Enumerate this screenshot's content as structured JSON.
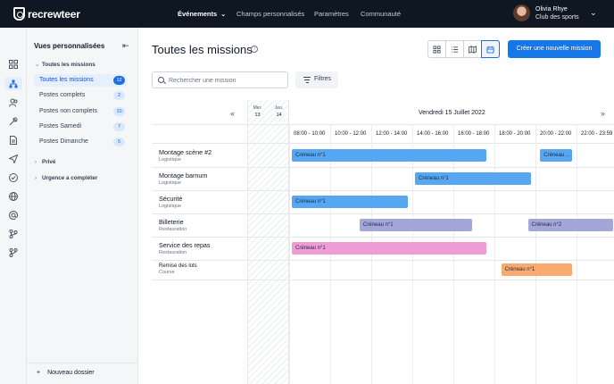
{
  "app": {
    "logo_text": "recrewteer"
  },
  "topnav": {
    "items": [
      "Événements",
      "Champs personnalisés",
      "Paramètres",
      "Communauté"
    ]
  },
  "user": {
    "name": "Olivia Rhye",
    "club": "Club des sports"
  },
  "panel": {
    "title": "Vues personnalisées",
    "group_missions": "Toutes les missions",
    "views": [
      {
        "label": "Toutes les missions",
        "count": "12"
      },
      {
        "label": "Postes complets",
        "count": "2"
      },
      {
        "label": "Postes non complets",
        "count": "10"
      },
      {
        "label": "Postes Samedi",
        "count": "7"
      },
      {
        "label": "Postes Dimanche",
        "count": "5"
      }
    ],
    "group_private": "Privé",
    "group_urgent": "Urgence a compléter",
    "new_folder": "Nouveau dossier"
  },
  "main": {
    "title": "Toutes les missions",
    "create_button": "Créer une nouvelle mission",
    "search_placeholder": "Rechercher une mission",
    "filter_label": "Filtres"
  },
  "calendar": {
    "date_title": "Vendredi 15 Juillet 2022",
    "prev_days": [
      {
        "name": "Mer.",
        "num": "13"
      },
      {
        "name": "Jeu.",
        "num": "14"
      }
    ],
    "slots": [
      "08:00 - 10:00",
      "10:00 - 12:00",
      "12:00 - 14:00",
      "14:00 - 16:00",
      "16:00 - 18:00",
      "18:00 - 20:00",
      "20:00 - 22:00",
      "22:00 - 23:59"
    ],
    "missions": [
      {
        "title": "Montage scène #2",
        "category": "Logistique"
      },
      {
        "title": "Montage barnum",
        "category": "Logistique"
      },
      {
        "title": "Sécurité",
        "category": "Logistique"
      },
      {
        "title": "Billeterie",
        "category": "Restauration"
      },
      {
        "title": "Service des repas",
        "category": "Restauration"
      },
      {
        "title": "Remise des lots",
        "category": "Course"
      }
    ],
    "shifts": [
      {
        "label": "Créneau n°1",
        "color": "#56a6f2"
      },
      {
        "label": "Créneau ...",
        "color": "#56a6f2"
      },
      {
        "label": "Créneau n°1",
        "color": "#56a6f2"
      },
      {
        "label": "Créneau n°1",
        "color": "#56a6f2"
      },
      {
        "label": "Créneau n°1",
        "color": "#a3a6d8"
      },
      {
        "label": "Créneau n°2",
        "color": "#a3a6d8"
      },
      {
        "label": "Créneau n°1",
        "color": "#ef9bd6"
      },
      {
        "label": "Créneau n°1",
        "color": "#f9ab6f"
      }
    ]
  },
  "colors": {
    "accent": "#1677e8",
    "topbar": "#0f1723"
  }
}
